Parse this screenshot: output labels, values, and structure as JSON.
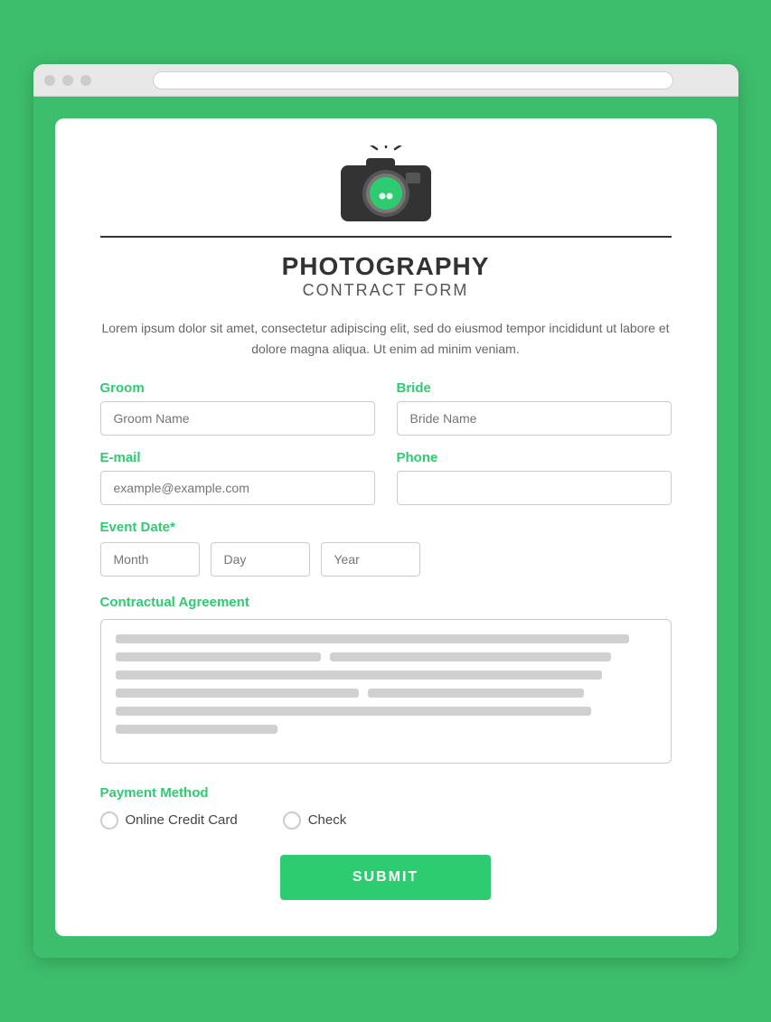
{
  "browser": {
    "dots": [
      "dot1",
      "dot2",
      "dot3"
    ]
  },
  "header": {
    "title": "PHOTOGRAPHY",
    "subtitle": "CONTRACT FORM"
  },
  "description": "Lorem ipsum dolor sit amet, consectetur adipiscing elit, sed do eiusmod tempor incididunt ut labore et dolore magna aliqua. Ut enim ad minim veniam.",
  "fields": {
    "groom_label": "Groom",
    "groom_placeholder": "Groom Name",
    "bride_label": "Bride",
    "bride_placeholder": "Bride Name",
    "email_label": "E-mail",
    "email_placeholder": "example@example.com",
    "phone_label": "Phone",
    "phone_placeholder": ""
  },
  "event_date": {
    "label": "Event Date*",
    "month_placeholder": "Month",
    "day_placeholder": "Day",
    "year_placeholder": "Year"
  },
  "contractual": {
    "label": "Contractual Agreement"
  },
  "payment": {
    "label": "Payment Method",
    "option1": "Online Credit Card",
    "option2": "Check"
  },
  "submit": {
    "label": "SUBMIT"
  }
}
